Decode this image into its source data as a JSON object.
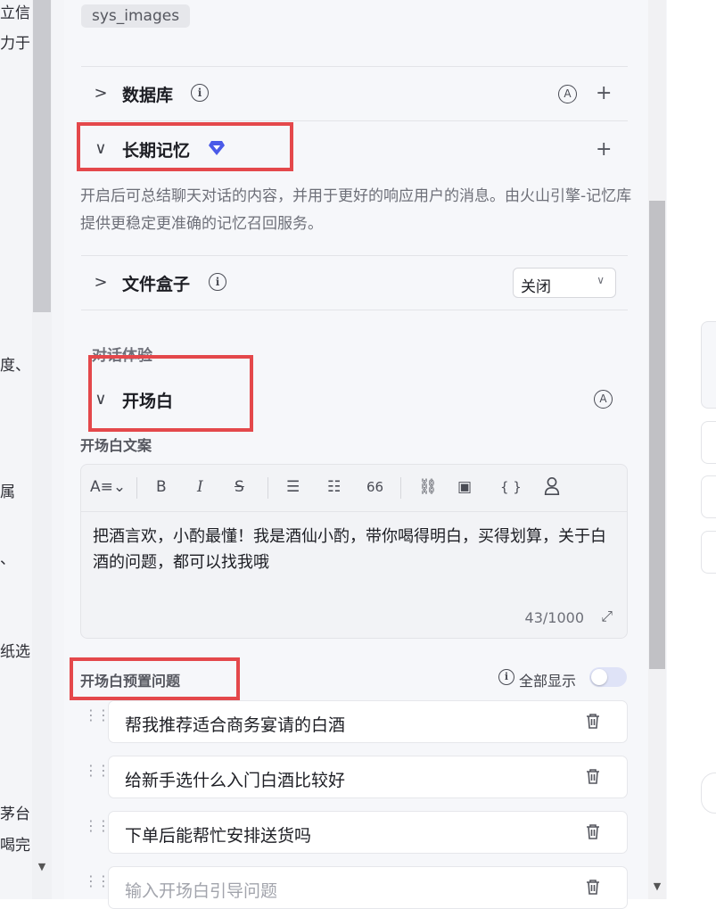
{
  "left_panel": {
    "fragments": [
      "立信",
      "力于",
      "度、",
      "属",
      "、",
      "纸选",
      "茅台",
      "喝完"
    ]
  },
  "system_tag": "sys_images",
  "database": {
    "title": "数据库"
  },
  "memory": {
    "title": "长期记忆",
    "description": "开启后可总结聊天对话的内容，并用于更好的响应用户的消息。由火山引擎-记忆库提供更稳定更准确的记忆召回服务。"
  },
  "file_box": {
    "title": "文件盒子",
    "select_value": "关闭"
  },
  "chat_experience": {
    "group_label": "对话体验",
    "opening": {
      "title": "开场白"
    },
    "opening_text_label": "开场白文案",
    "editor": {
      "content": "把酒言欢，小酌最懂！我是酒仙小酌，带你喝得明白，买得划算，关于白酒的问题，都可以找我哦",
      "counter": "43/1000"
    },
    "preset_questions": {
      "label": "开场白预置问题",
      "show_all_label": "全部显示",
      "show_all_on": false,
      "items": [
        "帮我推荐适合商务宴请的白酒",
        "给新手选什么入门白酒比较好",
        "下单后能帮忙安排送货吗"
      ],
      "placeholder": "输入开场白引导问题"
    }
  },
  "colors": {
    "highlight": "#e4484b",
    "premium_gem": "#4a5ae8"
  },
  "icons": {
    "toolbar": [
      "font-size-icon",
      "bold-icon",
      "italic-icon",
      "strikethrough-icon",
      "bullet-list-icon",
      "numbered-list-icon",
      "quote-icon",
      "link-icon",
      "image-icon",
      "code-icon",
      "user-icon"
    ]
  }
}
